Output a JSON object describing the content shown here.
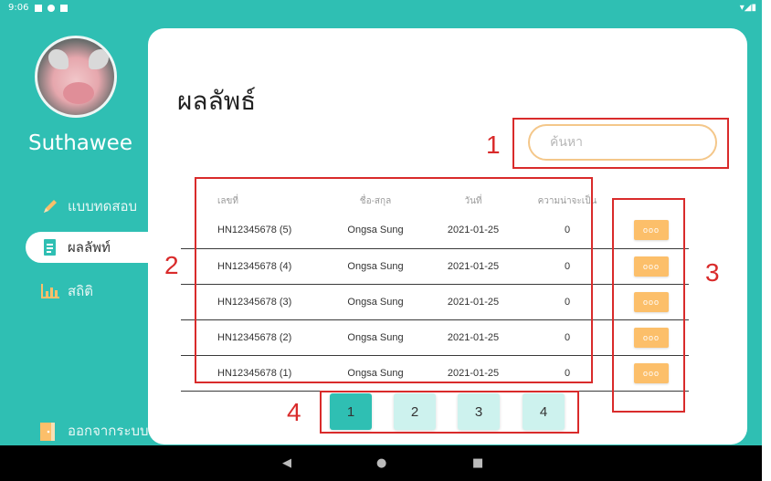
{
  "status_bar": {
    "time": "9:06"
  },
  "sidebar": {
    "username": "Suthawee",
    "items": [
      {
        "label": "แบบทดสอบ",
        "icon": "pencil-icon"
      },
      {
        "label": "ผลลัพท์",
        "icon": "document-icon"
      },
      {
        "label": "สถิติ",
        "icon": "bar-chart-icon"
      }
    ],
    "logout_label": "ออกจากระบบ",
    "logout_icon": "door-exit-icon"
  },
  "main": {
    "title": "ผลลัพธ์",
    "search": {
      "placeholder": "ค้นหา",
      "value": ""
    },
    "table": {
      "headers": [
        "เลขที่",
        "ชื่อ-สกุล",
        "วันที่",
        "ความน่าจะเป็น"
      ],
      "rows": [
        {
          "id": "HN12345678 (5)",
          "name": "Ongsa Sung",
          "date": "2021-01-25",
          "probability": "0",
          "action": "ooo"
        },
        {
          "id": "HN12345678 (4)",
          "name": "Ongsa Sung",
          "date": "2021-01-25",
          "probability": "0",
          "action": "ooo"
        },
        {
          "id": "HN12345678 (3)",
          "name": "Ongsa Sung",
          "date": "2021-01-25",
          "probability": "0",
          "action": "ooo"
        },
        {
          "id": "HN12345678 (2)",
          "name": "Ongsa Sung",
          "date": "2021-01-25",
          "probability": "0",
          "action": "ooo"
        },
        {
          "id": "HN12345678 (1)",
          "name": "Ongsa Sung",
          "date": "2021-01-25",
          "probability": "0",
          "action": "ooo"
        }
      ]
    },
    "pagination": {
      "pages": [
        "1",
        "2",
        "3",
        "4"
      ],
      "current": "1"
    }
  },
  "annotations": [
    "1",
    "2",
    "3",
    "4"
  ],
  "colors": {
    "teal": "#2fbfb3",
    "orange": "#fcbf6a",
    "annotation_red": "#d92b2b",
    "page_bg": "#cdf2ee"
  }
}
